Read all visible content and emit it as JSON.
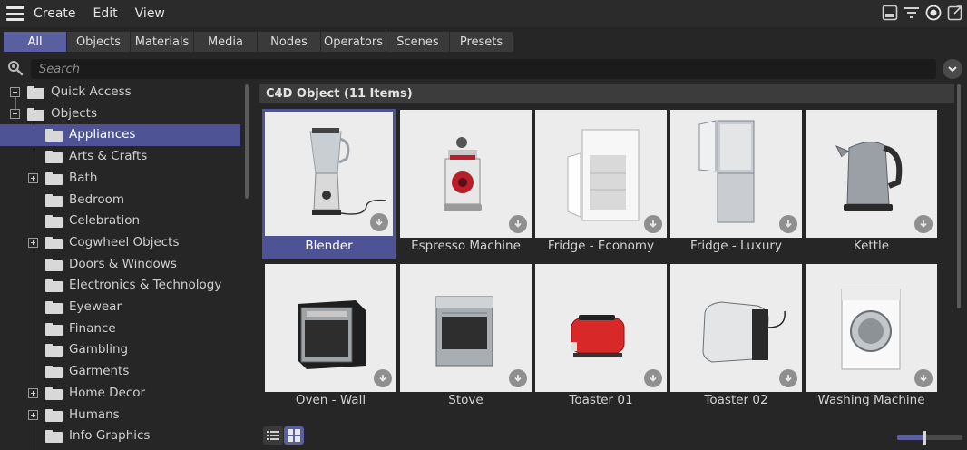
{
  "menubar": {
    "items": [
      "Create",
      "Edit",
      "View"
    ],
    "icons": [
      "window-layout-icon",
      "filter-icon",
      "radio-target-icon",
      "open-external-icon"
    ]
  },
  "tabs": [
    {
      "label": "All",
      "active": true
    },
    {
      "label": "Objects",
      "active": false
    },
    {
      "label": "Materials",
      "active": false
    },
    {
      "label": "Media",
      "active": false
    },
    {
      "label": "Nodes",
      "active": false
    },
    {
      "label": "Operators",
      "active": false
    },
    {
      "label": "Scenes",
      "active": false
    },
    {
      "label": "Presets",
      "active": false
    }
  ],
  "search": {
    "placeholder": "Search",
    "value": ""
  },
  "tree": [
    {
      "label": "Quick Access",
      "level": 0,
      "expander": "plus",
      "selected": false
    },
    {
      "label": "Objects",
      "level": 0,
      "expander": "minus",
      "selected": false
    },
    {
      "label": "Appliances",
      "level": 1,
      "expander": "none",
      "selected": true
    },
    {
      "label": "Arts & Crafts",
      "level": 1,
      "expander": "none",
      "selected": false
    },
    {
      "label": "Bath",
      "level": 1,
      "expander": "plus",
      "selected": false
    },
    {
      "label": "Bedroom",
      "level": 1,
      "expander": "none",
      "selected": false
    },
    {
      "label": "Celebration",
      "level": 1,
      "expander": "none",
      "selected": false
    },
    {
      "label": "Cogwheel Objects",
      "level": 1,
      "expander": "plus",
      "selected": false
    },
    {
      "label": "Doors & Windows",
      "level": 1,
      "expander": "none",
      "selected": false
    },
    {
      "label": "Electronics & Technology",
      "level": 1,
      "expander": "none",
      "selected": false
    },
    {
      "label": "Eyewear",
      "level": 1,
      "expander": "none",
      "selected": false
    },
    {
      "label": "Finance",
      "level": 1,
      "expander": "none",
      "selected": false
    },
    {
      "label": "Gambling",
      "level": 1,
      "expander": "none",
      "selected": false
    },
    {
      "label": "Garments",
      "level": 1,
      "expander": "none",
      "selected": false
    },
    {
      "label": "Home Decor",
      "level": 1,
      "expander": "plus",
      "selected": false
    },
    {
      "label": "Humans",
      "level": 1,
      "expander": "plus",
      "selected": false
    },
    {
      "label": "Info Graphics",
      "level": 1,
      "expander": "none",
      "selected": false
    }
  ],
  "section": {
    "title": "C4D Object (11 Items)"
  },
  "items": [
    {
      "name": "Blender",
      "icon": "blender-thumbnail",
      "selected": true
    },
    {
      "name": "Espresso Machine",
      "icon": "espresso-machine-thumbnail",
      "selected": false
    },
    {
      "name": "Fridge - Economy",
      "icon": "fridge-economy-thumbnail",
      "selected": false
    },
    {
      "name": "Fridge - Luxury",
      "icon": "fridge-luxury-thumbnail",
      "selected": false
    },
    {
      "name": "Kettle",
      "icon": "kettle-thumbnail",
      "selected": false
    },
    {
      "name": "Oven - Wall",
      "icon": "oven-wall-thumbnail",
      "selected": false
    },
    {
      "name": "Stove",
      "icon": "stove-thumbnail",
      "selected": false
    },
    {
      "name": "Toaster 01",
      "icon": "toaster-01-thumbnail",
      "selected": false
    },
    {
      "name": "Toaster 02",
      "icon": "toaster-02-thumbnail",
      "selected": false
    },
    {
      "name": "Washing Machine",
      "icon": "washing-machine-thumbnail",
      "selected": false
    }
  ],
  "bottombar": {
    "view_modes": [
      "list-view-icon",
      "grid-view-icon"
    ],
    "active_view": "grid",
    "zoom_level": 0.42
  },
  "colors": {
    "accent": "#5a5fa0",
    "selection": "#4d5394",
    "background": "#262626"
  }
}
